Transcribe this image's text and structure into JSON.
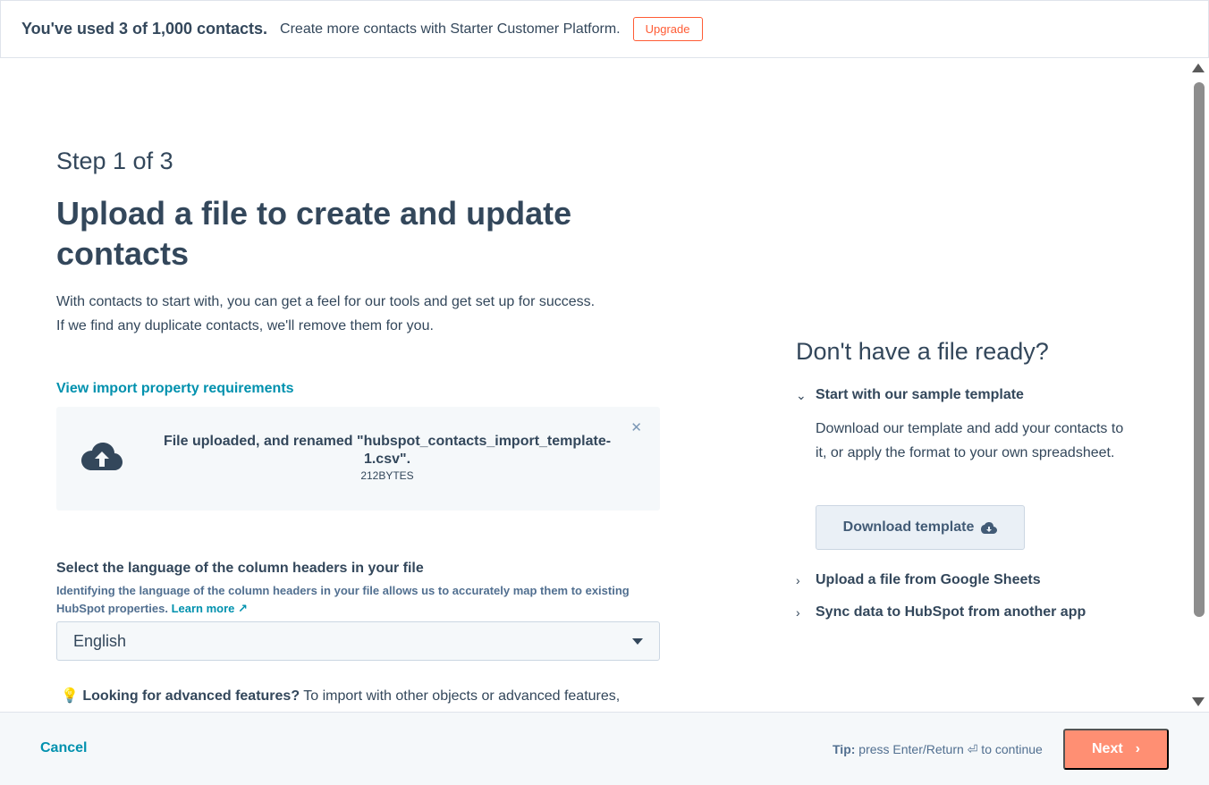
{
  "banner": {
    "usage_text": "You've used 3 of 1,000 contacts.",
    "promo_text": "Create more contacts with Starter Customer Platform.",
    "upgrade_label": "Upgrade"
  },
  "main": {
    "step": "Step 1 of 3",
    "title": "Upload a file to create and update contacts",
    "intro_line1": "With contacts to start with, you can get a feel for our tools and get set up for success.",
    "intro_line2": "If we find any duplicate contacts, we'll remove them for you.",
    "requirements_link": "View import property requirements",
    "upload": {
      "message": "File uploaded, and renamed \"hubspot_contacts_import_template-1.csv\".",
      "size": "212BYTES",
      "close_icon": "close-icon"
    },
    "language": {
      "label": "Select the language of the column headers in your file",
      "help": "Identifying the language of the column headers in your file allows us to accurately map them to existing HubSpot properties.",
      "learn_more": "Learn more",
      "selected": "English"
    },
    "advanced": {
      "bold": "Looking for advanced features?",
      "text": "To import with other objects or advanced features,"
    }
  },
  "sidebar": {
    "title": "Don't have a file ready?",
    "sample_template": {
      "label": "Start with our sample template",
      "description": "Download our template and add your contacts to it, or apply the format to your own spreadsheet.",
      "download_label": "Download template"
    },
    "google_sheets_label": "Upload a file from Google Sheets",
    "sync_label": "Sync data to HubSpot from another app"
  },
  "footer": {
    "cancel_label": "Cancel",
    "tip_bold": "Tip:",
    "tip_text": "press Enter/Return ⏎ to continue",
    "next_label": "Next"
  },
  "colors": {
    "accent": "#0091ae",
    "text": "#33475b",
    "upgrade": "#ff5c35",
    "next_button": "#ff8f73"
  }
}
